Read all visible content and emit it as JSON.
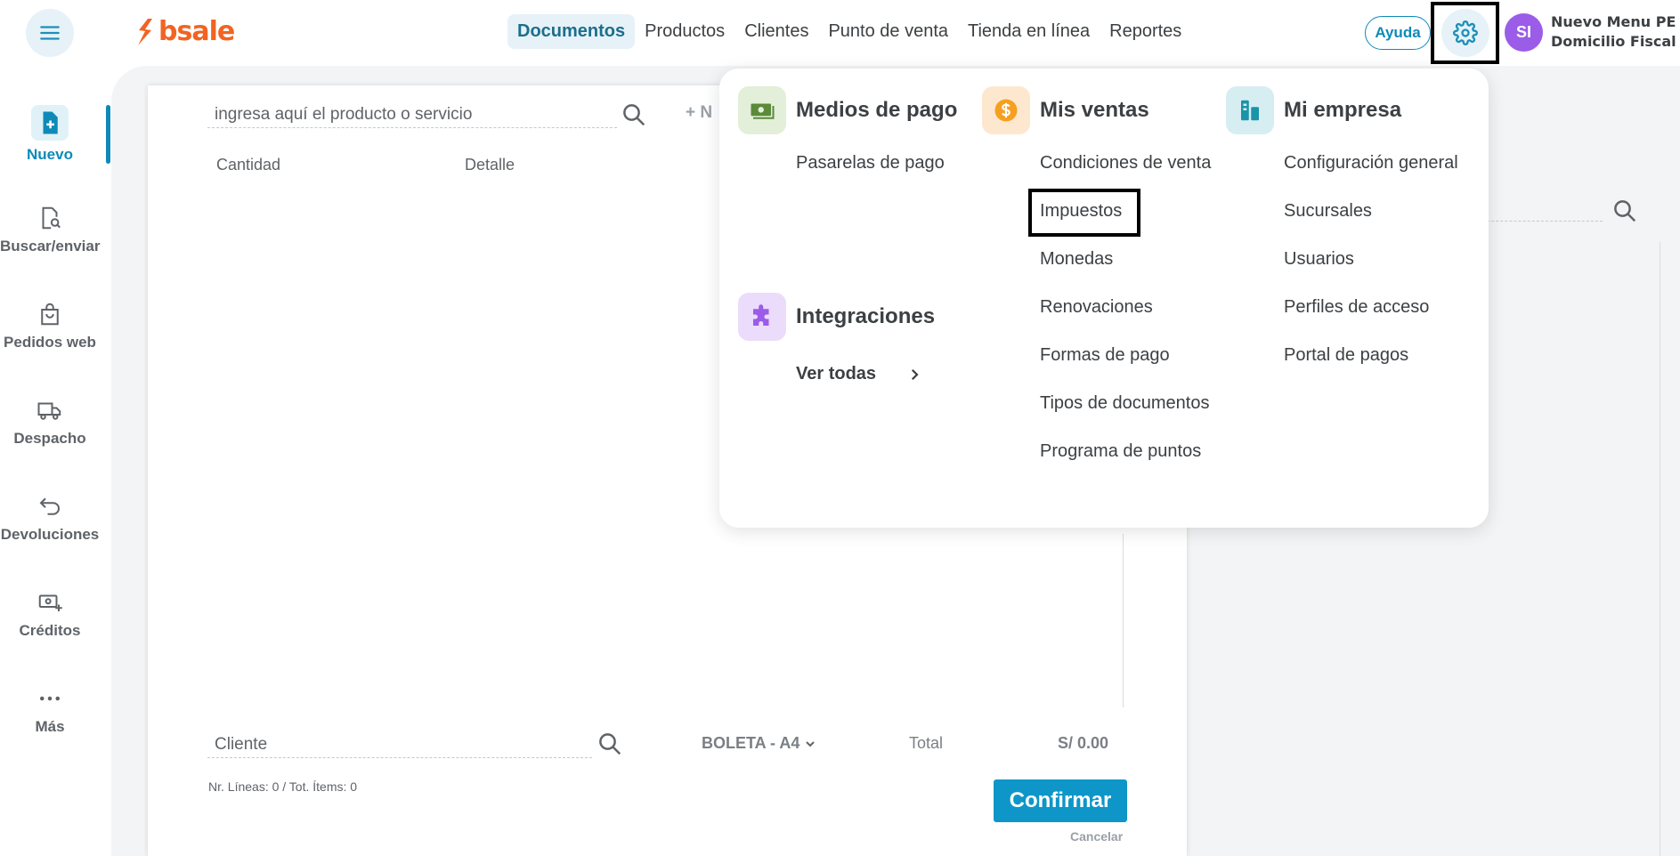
{
  "header": {
    "brand": "bsale",
    "nav": [
      {
        "label": "Documentos",
        "active": true
      },
      {
        "label": "Productos"
      },
      {
        "label": "Clientes"
      },
      {
        "label": "Punto de venta"
      },
      {
        "label": "Tienda en línea"
      },
      {
        "label": "Reportes"
      }
    ],
    "help_label": "Ayuda",
    "avatar_initials": "SI",
    "company_line1": "Nuevo Menu PE",
    "company_line2": "Domicilio Fiscal"
  },
  "sidebar": {
    "items": [
      {
        "label": "Nuevo",
        "icon": "file-plus-icon",
        "active": true
      },
      {
        "label": "Buscar/enviar",
        "icon": "file-search-icon"
      },
      {
        "label": "Pedidos web",
        "icon": "shopping-bag-icon"
      },
      {
        "label": "Despacho",
        "icon": "truck-icon"
      },
      {
        "label": "Devoluciones",
        "icon": "return-arrow-icon"
      },
      {
        "label": "Créditos",
        "icon": "money-plus-icon"
      },
      {
        "label": "Más",
        "icon": "more-dots-icon"
      }
    ]
  },
  "document": {
    "search_placeholder": "ingresa aquí el producto o servicio",
    "new_label": "+ N",
    "columns": [
      "Cantidad",
      "Detalle"
    ],
    "client_placeholder": "Cliente",
    "doc_type": "BOLETA - A4",
    "total_label": "Total",
    "total_value": "S/ 0.00",
    "lines_info": "Nr. Líneas: 0 / Tot. Ítems: 0",
    "confirm_label": "Confirmar",
    "cancel_label": "Cancelar"
  },
  "settings_menu": {
    "payment": {
      "title": "Medios de pago",
      "icon": "money-bill-icon",
      "links": [
        "Pasarelas de pago"
      ]
    },
    "integrations": {
      "title": "Integraciones",
      "icon": "puzzle-icon",
      "see_all": "Ver todas"
    },
    "sales": {
      "title": "Mis ventas",
      "icon": "dollar-coin-icon",
      "links": [
        "Condiciones de venta",
        "Impuestos",
        "Monedas",
        "Renovaciones",
        "Formas de pago",
        "Tipos de documentos",
        "Programa de puntos"
      ]
    },
    "company": {
      "title": "Mi empresa",
      "icon": "building-icon",
      "links": [
        "Configuración general",
        "Sucursales",
        "Usuarios",
        "Perfiles de acceso",
        "Portal de pagos"
      ]
    }
  },
  "colors": {
    "accent": "#0e8ab8",
    "brand": "#f26322",
    "avatar": "#9b5ce8",
    "confirm": "#0e96c8"
  }
}
